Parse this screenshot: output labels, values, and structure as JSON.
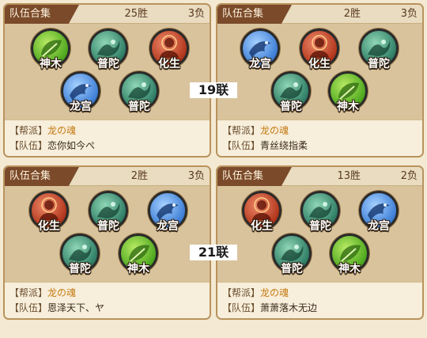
{
  "link_labels": [
    "19联",
    "21联"
  ],
  "cards": [
    {
      "title": "队伍合集",
      "wins": "25胜",
      "losses": "3负",
      "guild_label": "【帮派】",
      "guild": "龙の魂",
      "team_label": "【队伍】",
      "team": "恋你如今ぺ",
      "units": [
        "神木",
        "普陀",
        "化生",
        "龙宫",
        "普陀"
      ],
      "unit_icons": [
        "leaf-emblem-icon",
        "wave-emblem-icon",
        "buddha-emblem-icon",
        "dragon-emblem-icon",
        "wave-emblem-icon"
      ]
    },
    {
      "title": "队伍合集",
      "wins": "2胜",
      "losses": "3负",
      "guild_label": "【帮派】",
      "guild": "龙の魂",
      "team_label": "【队伍】",
      "team": "青丝绕指柔",
      "units": [
        "龙宫",
        "化生",
        "普陀",
        "普陀",
        "神木"
      ],
      "unit_icons": [
        "dragon-emblem-icon",
        "buddha-emblem-icon",
        "wave-emblem-icon",
        "wave-emblem-icon",
        "leaf-emblem-icon"
      ]
    },
    {
      "title": "队伍合集",
      "wins": "2胜",
      "losses": "3负",
      "guild_label": "【帮派】",
      "guild": "龙の魂",
      "team_label": "【队伍】",
      "team": "恩泽天下、ヤ",
      "units": [
        "化生",
        "普陀",
        "龙宫",
        "普陀",
        "神木"
      ],
      "unit_icons": [
        "buddha-emblem-icon",
        "wave-emblem-icon",
        "dragon-emblem-icon",
        "wave-emblem-icon",
        "leaf-emblem-icon"
      ]
    },
    {
      "title": "队伍合集",
      "wins": "13胜",
      "losses": "2负",
      "guild_label": "【帮派】",
      "guild": "龙の魂",
      "team_label": "【队伍】",
      "team": "萧萧落木无边",
      "units": [
        "化生",
        "普陀",
        "龙宫",
        "普陀",
        "神木"
      ],
      "unit_icons": [
        "buddha-emblem-icon",
        "wave-emblem-icon",
        "dragon-emblem-icon",
        "wave-emblem-icon",
        "leaf-emblem-icon"
      ]
    }
  ]
}
